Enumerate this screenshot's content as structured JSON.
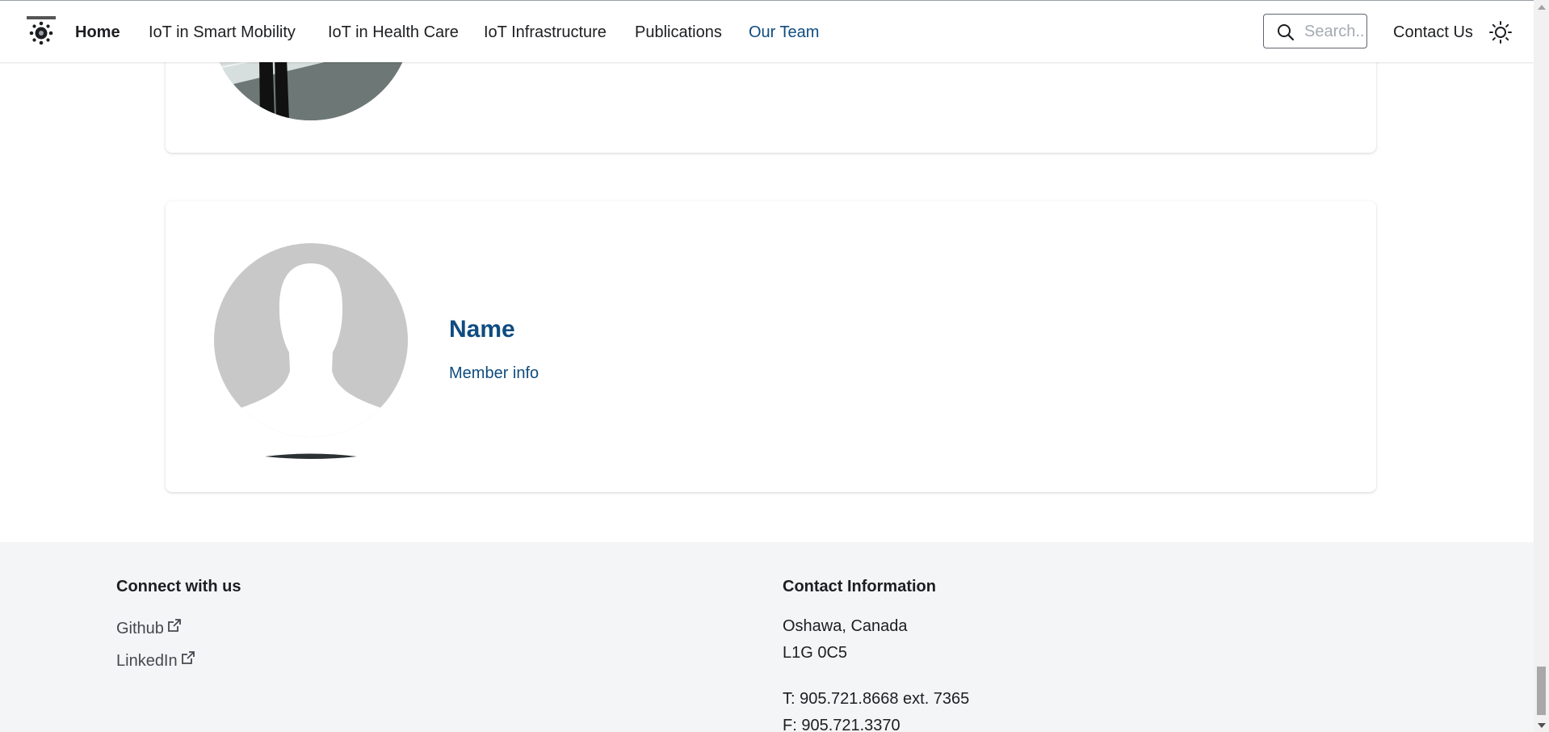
{
  "nav": {
    "links": {
      "home": "Home",
      "smart_mobility": "IoT in Smart Mobility",
      "health_care": "IoT in Health Care",
      "infrastructure": "IoT Infrastructure",
      "publications": "Publications",
      "our_team": "Our Team"
    },
    "active_link": "our_team",
    "search_placeholder": "Search...",
    "contact": "Contact Us",
    "logo_icon": "lab-logo-icon",
    "theme_icon": "sun-icon"
  },
  "team": {
    "member": {
      "name": "Name",
      "info": "Member info"
    }
  },
  "footer": {
    "connect": {
      "heading": "Connect with us",
      "links": [
        "Github",
        "LinkedIn"
      ]
    },
    "contact": {
      "heading": "Contact Information",
      "city": "Oshawa, Canada",
      "postal": "L1G 0C5",
      "phone": "T: 905.721.8668 ext. 7365",
      "fax": "F: 905.721.3370"
    }
  },
  "colors": {
    "accent": "#0f4c81",
    "footer_bg": "#f4f5f6",
    "text": "#1c1e21"
  }
}
